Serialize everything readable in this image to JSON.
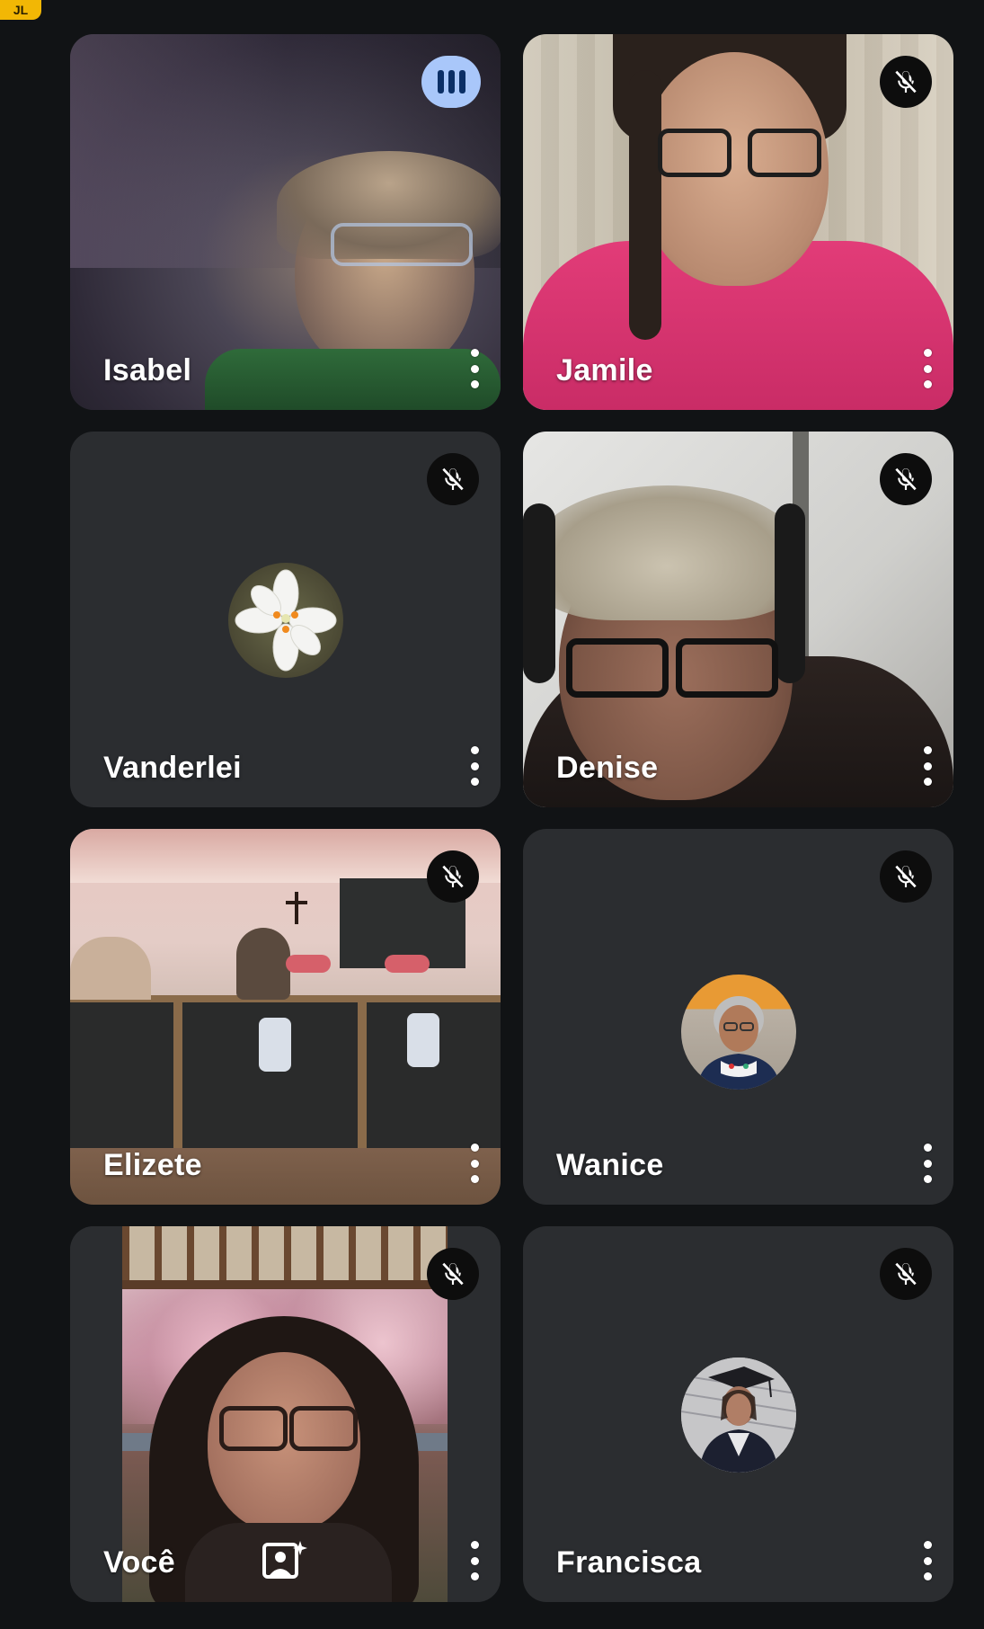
{
  "corner_badge": "JL",
  "participants": [
    {
      "name": "Isabel",
      "status": "speaking"
    },
    {
      "name": "Jamile",
      "status": "muted"
    },
    {
      "name": "Vanderlei",
      "status": "muted"
    },
    {
      "name": "Denise",
      "status": "muted"
    },
    {
      "name": "Elizete",
      "status": "muted"
    },
    {
      "name": "Wanice",
      "status": "muted"
    },
    {
      "name": "Você",
      "status": "muted"
    },
    {
      "name": "Francisca",
      "status": "muted"
    }
  ],
  "colors": {
    "background": "#111315",
    "tile": "#2b2d30",
    "speaking_indicator": "#a9c7fa",
    "muted_badge": "#0d0d0d",
    "badge_accent": "#f2b705"
  },
  "icons": {
    "muted": "mic-off-icon",
    "speaking": "audio-level-icon",
    "menu": "more-vert-icon",
    "effects": "visual-effects-icon"
  }
}
